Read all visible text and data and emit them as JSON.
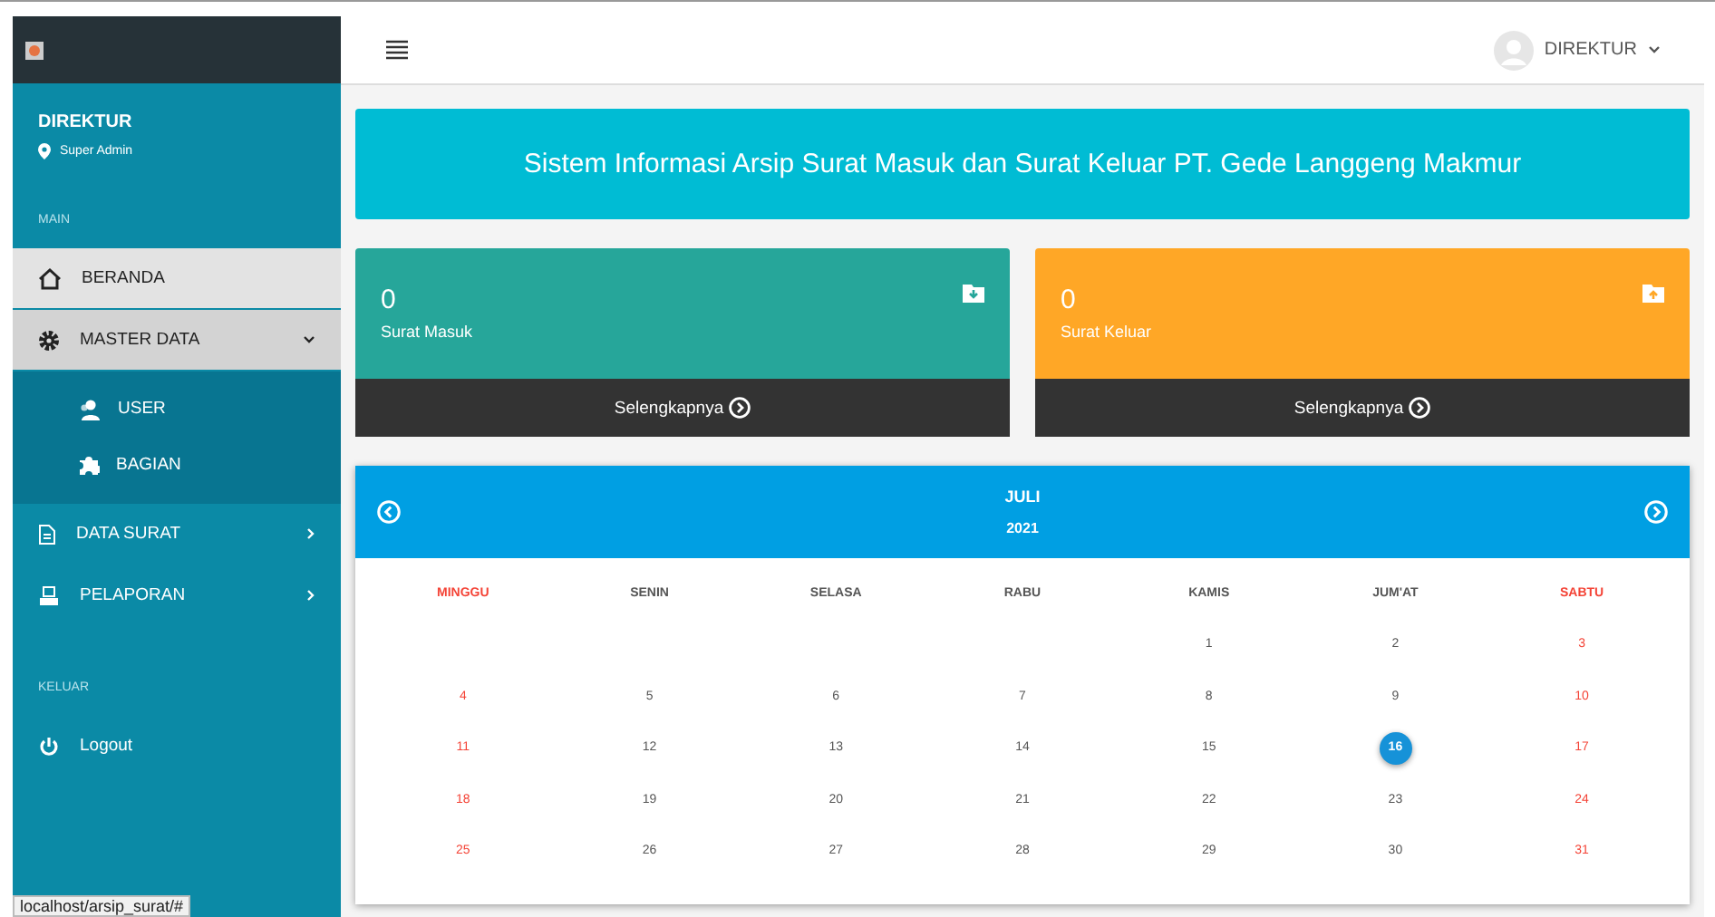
{
  "user": {
    "name": "DIREKTUR",
    "role": "Super Admin"
  },
  "topbar": {
    "user_label": "DIREKTUR"
  },
  "sidebar": [
    {
      "kind": "header",
      "label": "MAIN"
    },
    {
      "kind": "item",
      "label": "BERANDA",
      "selected": true
    },
    {
      "kind": "item",
      "label": "MASTER DATA",
      "selected": false,
      "expanded": true,
      "children": [
        {
          "label": "USER"
        },
        {
          "label": "BAGIAN"
        }
      ]
    },
    {
      "kind": "item",
      "label": "DATA SURAT",
      "selected": false,
      "expanded": false
    },
    {
      "kind": "item",
      "label": "PELAPORAN",
      "selected": false,
      "expanded": false
    },
    {
      "kind": "header",
      "label": "KELUAR"
    },
    {
      "kind": "item",
      "label": "Logout",
      "selected": false
    }
  ],
  "banner": "Sistem Informasi Arsip Surat Masuk dan Surat Keluar PT. Gede Langgeng Makmur",
  "stats": [
    {
      "count": "0",
      "label": "Surat Masuk",
      "link": "Selengkapnya",
      "color": "#26a69a"
    },
    {
      "count": "0",
      "label": "Surat Keluar",
      "link": "Selengkapnya",
      "color": "#ffa726"
    }
  ],
  "calendar": {
    "month": "JULI",
    "year": "2021",
    "weekdays": [
      {
        "label": "MINGGU",
        "weekend": true
      },
      {
        "label": "SENIN",
        "weekend": false
      },
      {
        "label": "SELASA",
        "weekend": false
      },
      {
        "label": "RABU",
        "weekend": false
      },
      {
        "label": "KAMIS",
        "weekend": false
      },
      {
        "label": "JUM'AT",
        "weekend": false
      },
      {
        "label": "SABTU",
        "weekend": true
      }
    ],
    "weeks": [
      [
        {
          "day": "1",
          "weekend": false,
          "selected": false
        },
        {
          "day": "2",
          "weekend": false,
          "selected": false
        },
        {
          "day": "3",
          "weekend": true,
          "selected": false
        }
      ],
      [
        {
          "day": "4",
          "weekend": true,
          "selected": false
        },
        {
          "day": "5",
          "weekend": false,
          "selected": false
        },
        {
          "day": "6",
          "weekend": false,
          "selected": false
        },
        {
          "day": "7",
          "weekend": false,
          "selected": false
        },
        {
          "day": "8",
          "weekend": false,
          "selected": false
        },
        {
          "day": "9",
          "weekend": false,
          "selected": false
        },
        {
          "day": "10",
          "weekend": true,
          "selected": false
        }
      ],
      [
        {
          "day": "11",
          "weekend": true,
          "selected": false
        },
        {
          "day": "12",
          "weekend": false,
          "selected": false
        },
        {
          "day": "13",
          "weekend": false,
          "selected": false
        },
        {
          "day": "14",
          "weekend": false,
          "selected": false
        },
        {
          "day": "15",
          "weekend": false,
          "selected": false
        },
        {
          "day": "16",
          "weekend": false,
          "selected": true
        },
        {
          "day": "17",
          "weekend": true,
          "selected": false
        }
      ],
      [
        {
          "day": "18",
          "weekend": true,
          "selected": false
        },
        {
          "day": "19",
          "weekend": false,
          "selected": false
        },
        {
          "day": "20",
          "weekend": false,
          "selected": false
        },
        {
          "day": "21",
          "weekend": false,
          "selected": false
        },
        {
          "day": "22",
          "weekend": false,
          "selected": false
        },
        {
          "day": "23",
          "weekend": false,
          "selected": false
        },
        {
          "day": "24",
          "weekend": true,
          "selected": false
        }
      ],
      [
        {
          "day": "25",
          "weekend": true,
          "selected": false
        },
        {
          "day": "26",
          "weekend": false,
          "selected": false
        },
        {
          "day": "27",
          "weekend": false,
          "selected": false
        },
        {
          "day": "28",
          "weekend": false,
          "selected": false
        },
        {
          "day": "29",
          "weekend": false,
          "selected": false
        },
        {
          "day": "30",
          "weekend": false,
          "selected": false
        },
        {
          "day": "31",
          "weekend": true,
          "selected": false
        }
      ]
    ]
  },
  "status_url": "localhost/arsip_surat/#"
}
